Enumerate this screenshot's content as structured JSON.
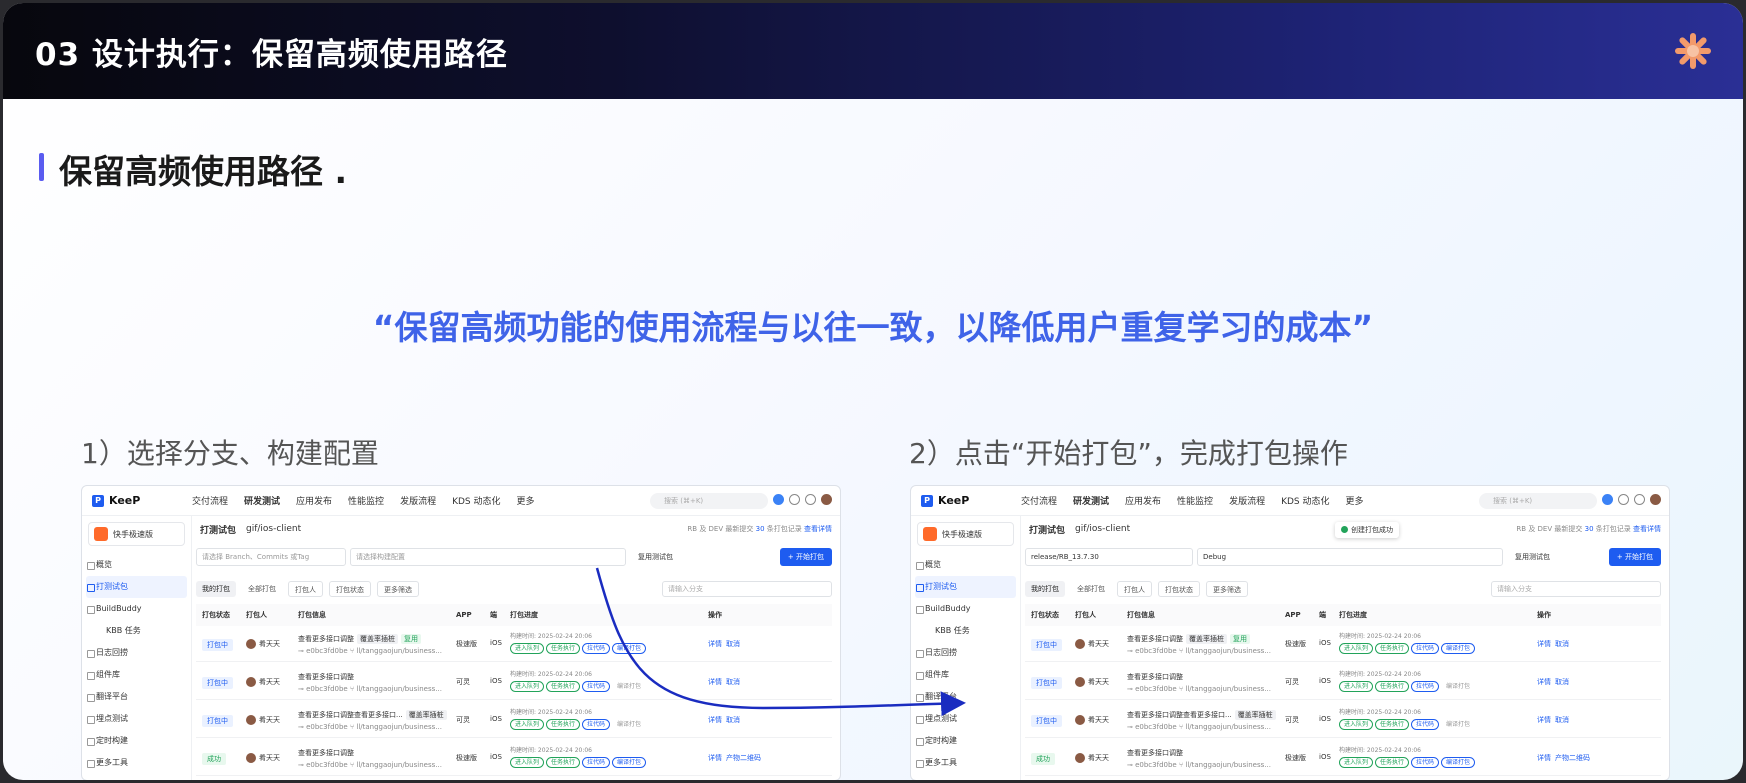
{
  "header": {
    "title": "03  设计执行：保留高频使用路径"
  },
  "section": {
    "title": "保留高频使用路径 ."
  },
  "quote": "“保留高频功能的使用流程与以往一致，以降低用户重复学习的成本”",
  "steps": {
    "one": "1）选择分支、构建配置",
    "two": "2）点击“开始打包”，完成打包操作"
  },
  "app": {
    "brand": "KeeP",
    "nav": [
      "交付流程",
      "研发测试",
      "应用发布",
      "性能监控",
      "发版流程",
      "KDS 动态化",
      "更多"
    ],
    "search_placeholder": "搜索 (⌘+K)",
    "app_selector": "快手极速版",
    "menu": [
      "概览",
      "打测试包",
      "BuildBuddy",
      "KBB 任务",
      "日志回捞",
      "组件库",
      "翻译平台",
      "埋点测试",
      "定时构建",
      "更多工具"
    ],
    "crumb": {
      "title": "打测试包",
      "repo": "gif/ios-client"
    },
    "crumb_right": {
      "text": "RB 及 DEV 最新提交",
      "count": "30",
      "text2": "条打包记录",
      "link": "查看详情"
    },
    "tabs": {
      "mine": "我的打包",
      "all": "全部打包",
      "packer": "打包人",
      "status": "打包状态",
      "more": "更多筛选"
    },
    "branch_input_placeholder": "请输入分支",
    "reuse_label": "复用测试包",
    "start_button": "+ 开始打包",
    "columns": [
      "打包状态",
      "打包人",
      "打包信息",
      "APP",
      "端",
      "打包进度",
      "操作"
    ],
    "rows": [
      {
        "status": "打包中",
        "user": "肴天天",
        "title": "查看更多接口调整",
        "tag1": "覆盖率插桩",
        "tag2": "复用",
        "commit": "e0bc3fd0be",
        "branch": "ll/tanggaojun/business...",
        "app": "极速版",
        "platform": "iOS",
        "time": "构建时间: 2025-02-24 20:06",
        "pills": [
          "进入队列",
          "任务执行",
          "拉代码",
          "编译打包"
        ],
        "actions": [
          "详情",
          "取消"
        ]
      },
      {
        "status": "打包中",
        "user": "肴天天",
        "title": "查看更多接口调整",
        "tag1": "",
        "tag2": "",
        "commit": "e0bc3fd0be",
        "branch": "ll/tanggaojun/business...",
        "app": "可灵",
        "platform": "iOS",
        "time": "构建时间: 2025-02-24 20:06",
        "pills": [
          "进入队列",
          "任务执行",
          "拉代码",
          "编译打包"
        ],
        "actions": [
          "详情",
          "取消"
        ]
      },
      {
        "status": "打包中",
        "user": "肴天天",
        "title": "查看更多接口调整查看更多接口...",
        "tag1": "覆盖率插桩",
        "tag2": "",
        "commit": "e0bc3fd0be",
        "branch": "ll/tanggaojun/business...",
        "app": "可灵",
        "platform": "iOS",
        "time": "构建时间: 2025-02-24 20:06",
        "pills": [
          "进入队列",
          "任务执行",
          "拉代码",
          "编译打包"
        ],
        "actions": [
          "详情",
          "取消"
        ]
      },
      {
        "status": "成功",
        "user": "肴天天",
        "title": "查看更多接口调整",
        "tag1": "",
        "tag2": "",
        "commit": "e0bc3fd0be",
        "branch": "ll/tanggaojun/business...",
        "app": "极速版",
        "platform": "iOS",
        "time": "构建时间: 2025-02-24 20:06",
        "pills": [
          "进入队列",
          "任务执行",
          "拉代码",
          "编译打包"
        ],
        "actions": [
          "详情",
          "产物二维码"
        ]
      }
    ]
  },
  "shot1": {
    "branch_placeholder": "请选择 Branch、Commits 或Tag",
    "config_placeholder": "请选择构建配置"
  },
  "shot2": {
    "branch_value": "release/RB_13.7.30",
    "config_value": "Debug",
    "toast": "创建打包成功"
  },
  "colors": {
    "accent": "#1e5cf0",
    "quote": "#3f63e8",
    "success": "#22a35a",
    "arrow": "#1a2cc0"
  }
}
